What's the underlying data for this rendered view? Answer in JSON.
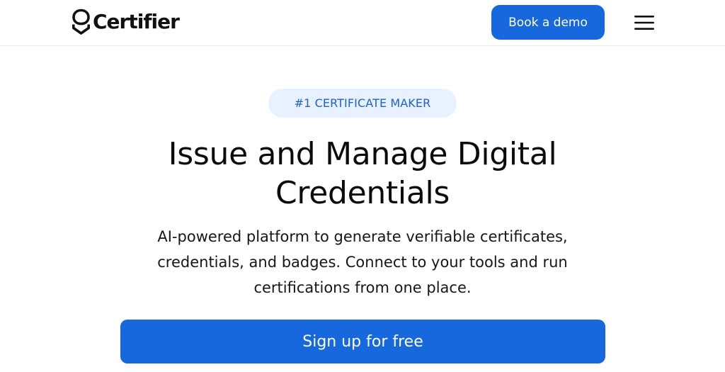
{
  "header": {
    "logo_text": "Certifier",
    "logo_icon": "certifier-shield-icon",
    "book_demo_label": "Book a demo",
    "menu_icon": "hamburger-menu-icon"
  },
  "hero": {
    "badge": "#1 CERTIFICATE MAKER",
    "title": "Issue and Manage Digital Credentials",
    "subtitle": "AI-powered platform to generate verifiable certificates, credentials, and badges. Connect to your tools and run certifications from one place.",
    "signup_label": "Sign up for free"
  },
  "colors": {
    "accent": "#1668dc",
    "badge_bg": "#e8f1ff",
    "badge_text": "#1f62c7",
    "text": "#0b0b0b"
  }
}
